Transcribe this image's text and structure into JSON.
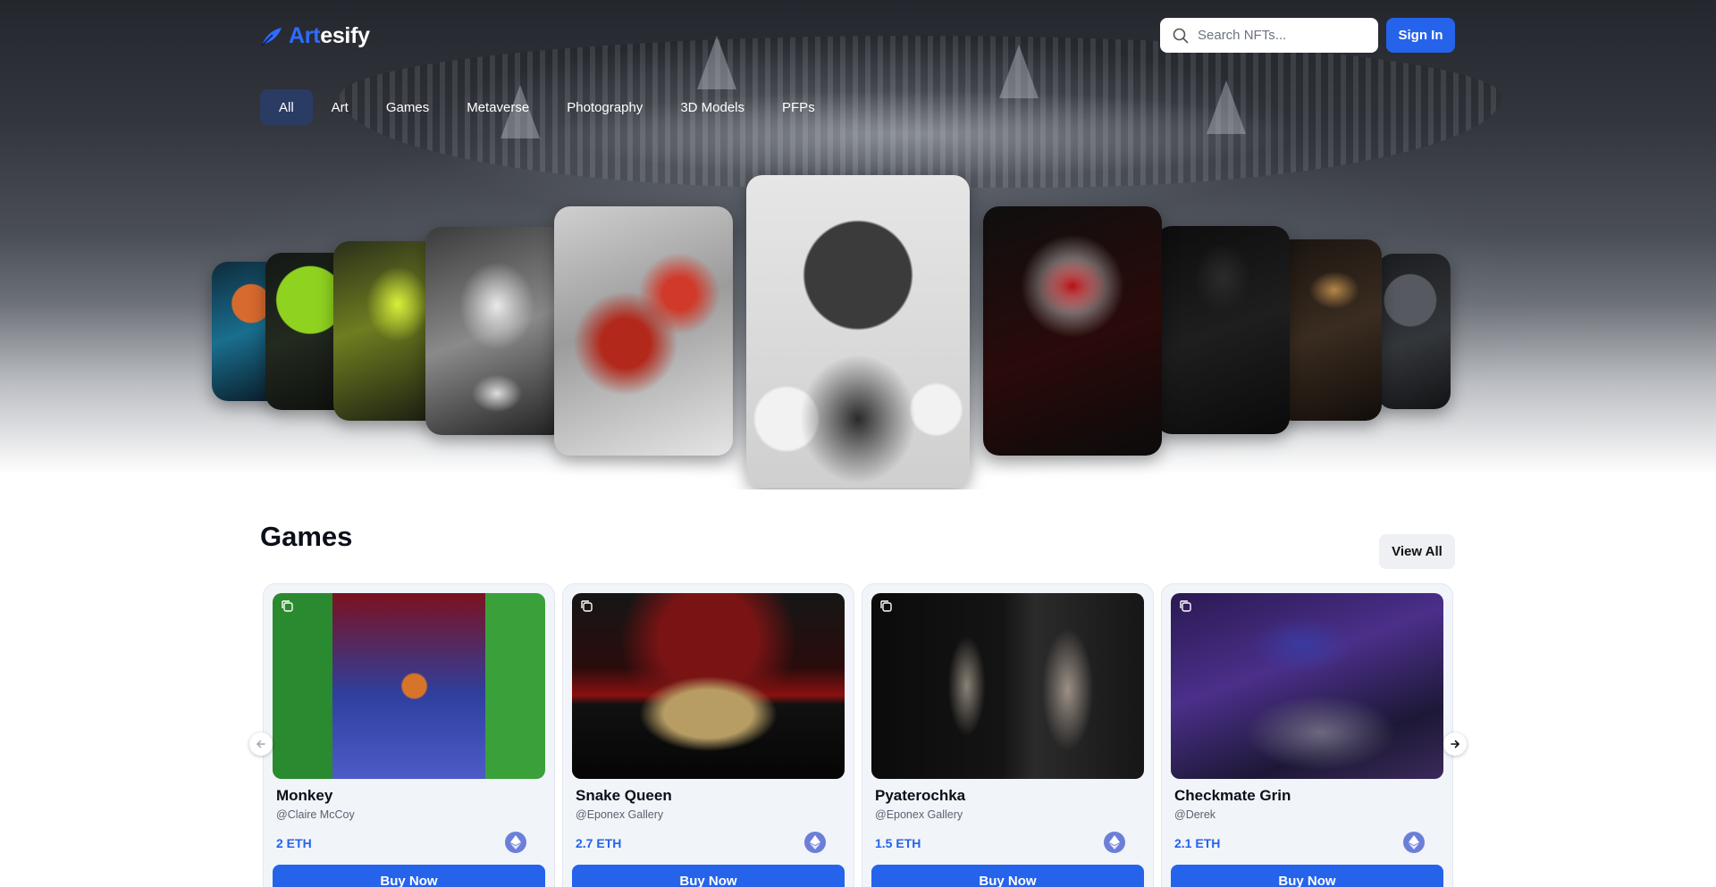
{
  "header": {
    "logo_prefix": "Art",
    "logo_suffix": "esify",
    "search_placeholder": "Search NFTs...",
    "signin_label": "Sign In"
  },
  "tabs": [
    {
      "label": "All",
      "active": true
    },
    {
      "label": "Art"
    },
    {
      "label": "Games"
    },
    {
      "label": "Metaverse"
    },
    {
      "label": "Photography"
    },
    {
      "label": "3D Models"
    },
    {
      "label": "PFPs"
    }
  ],
  "hero": {
    "featured_cards": [
      "neon-portrait",
      "green-figure",
      "yellow-figure",
      "white-mask",
      "abstract-red",
      "crowned-ball-head",
      "red-helmet-astronaut",
      "dark-veiled-figure",
      "blonde-blindfold",
      "gas-mask-figure"
    ]
  },
  "games": {
    "section_title": "Games",
    "view_all_label": "View All",
    "buy_label": "Buy Now",
    "cards": [
      {
        "title": "Monkey",
        "creator": "@Claire McCoy",
        "price": "2 ETH"
      },
      {
        "title": "Snake Queen",
        "creator": "@Eponex Gallery",
        "price": "2.7 ETH"
      },
      {
        "title": "Pyaterochka",
        "creator": "@Eponex Gallery",
        "price": "1.5 ETH"
      },
      {
        "title": "Checkmate Grin",
        "creator": "@Derek",
        "price": "2.1 ETH"
      }
    ]
  },
  "colors": {
    "accent": "#2563eb",
    "active_tab": "#2a3b64",
    "eth_badge": "#6c7fd8"
  },
  "icons": [
    "feather-logo-icon",
    "search-icon",
    "copy-icon",
    "ethereum-icon",
    "arrow-left-icon",
    "arrow-right-icon"
  ]
}
